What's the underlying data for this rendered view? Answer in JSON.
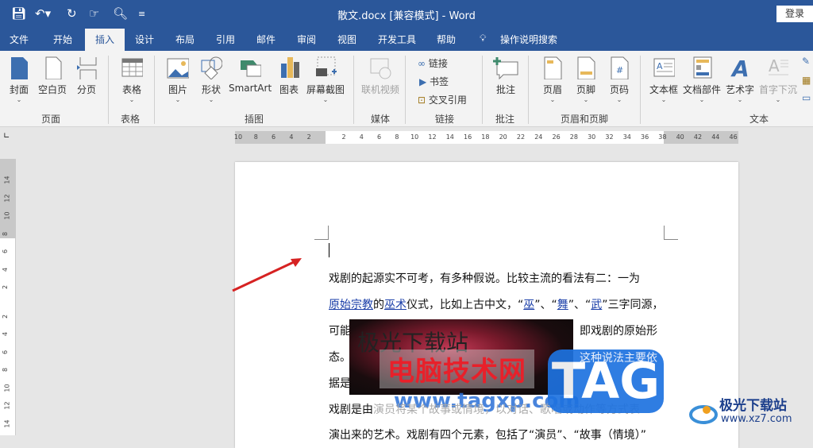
{
  "titlebar": {
    "title": "散文.docx [兼容模式]  -  Word",
    "login": "登录"
  },
  "tabs": [
    "文件",
    "开始",
    "插入",
    "设计",
    "布局",
    "引用",
    "邮件",
    "审阅",
    "视图",
    "开发工具",
    "帮助",
    "操作说明搜索"
  ],
  "ribbon": {
    "pages": {
      "label": "页面",
      "items": [
        "封面",
        "空白页",
        "分页"
      ]
    },
    "tables": {
      "label": "表格",
      "items": [
        "表格"
      ]
    },
    "illustrations": {
      "label": "插图",
      "items": [
        "图片",
        "形状",
        "SmartArt",
        "图表",
        "屏幕截图"
      ]
    },
    "media": {
      "label": "媒体",
      "items": [
        "联机视频"
      ]
    },
    "links": {
      "label": "链接",
      "items": [
        "链接",
        "书签",
        "交叉引用"
      ]
    },
    "comments": {
      "label": "批注",
      "items": [
        "批注"
      ]
    },
    "headerfooter": {
      "label": "页眉和页脚",
      "items": [
        "页眉",
        "页脚",
        "页码"
      ]
    },
    "text": {
      "label": "文本",
      "items": [
        "文本框",
        "文档部件",
        "艺术字",
        "首字下沉"
      ]
    }
  },
  "ruler": {
    "h": [
      "10",
      "8",
      "6",
      "4",
      "2",
      "2",
      "4",
      "6",
      "8",
      "10",
      "12",
      "14",
      "16",
      "18",
      "20",
      "22",
      "24",
      "26",
      "28",
      "30",
      "32",
      "34",
      "36",
      "38",
      "40",
      "42",
      "44",
      "46"
    ],
    "v": [
      "14",
      "12",
      "10",
      "8",
      "6",
      "4",
      "2",
      "2",
      "4",
      "6",
      "8",
      "10",
      "12",
      "14"
    ]
  },
  "document": {
    "l1": "戏剧的起源实不可考，有多种假说。比较主流的看法有二：一为",
    "l2a": "原始宗教",
    "l2b": "的",
    "l2c": "巫术",
    "l2d": "仪式，比如上古中文，“",
    "l2e": "巫",
    "l2f": "”、“",
    "l2g": "舞",
    "l2h": "”、“",
    "l2i": "武",
    "l2j": "”三字同源，",
    "l3a": "可能",
    "l3b": "即戏剧的原始形",
    "l4a": "态。",
    "l4b": "这种说法主要依",
    "l5a": "据是",
    "l6a": "戏剧是由",
    "l6b": "演员将某个故事或情境，以对话、歌唱或动作等方式表",
    "l7": "演出来的艺术。戏剧有四个元素，包括了“演员”、“故事（情境）”"
  },
  "watermarks": {
    "image_text": "极光下载站",
    "red": "电脑技术网",
    "url": "www.tagxp.com",
    "tag": "TAG",
    "logo_name": "极光下载站",
    "logo_url": "www.xz7.com"
  }
}
